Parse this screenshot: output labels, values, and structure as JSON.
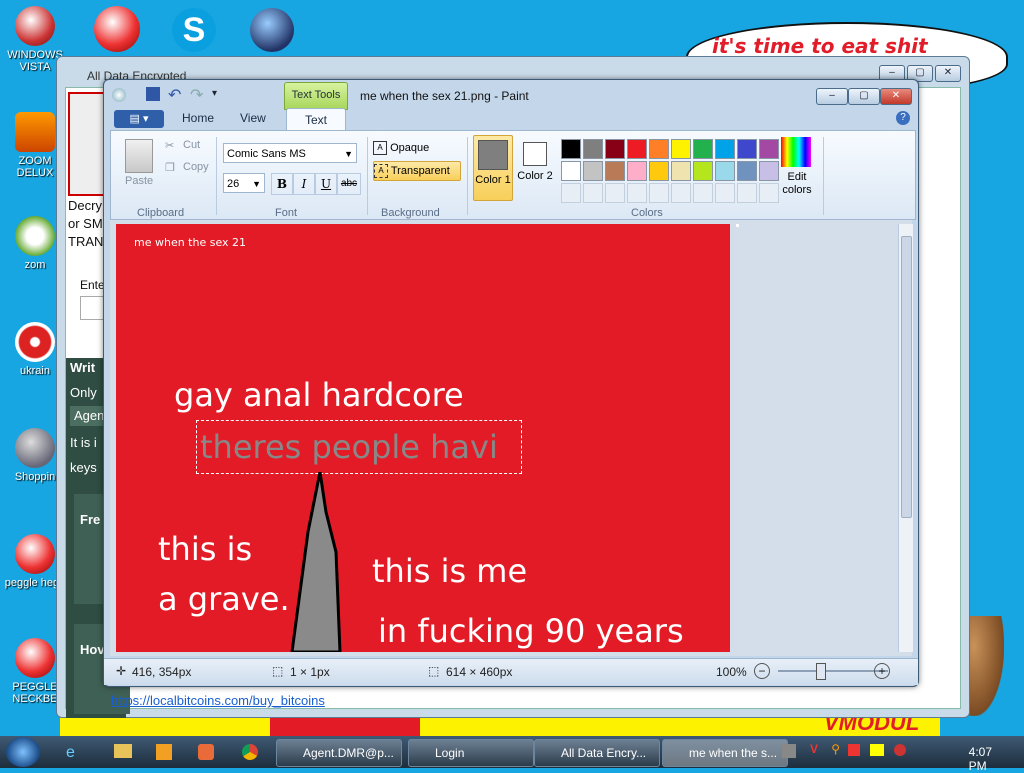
{
  "desktop": {
    "icons": [
      {
        "label": "WINDOWS VISTA"
      },
      {
        "label": "ZOOM DELUX"
      },
      {
        "label": "zom"
      },
      {
        "label": "ukrain"
      },
      {
        "label": "Shoppin"
      },
      {
        "label": "peggle hegg"
      },
      {
        "label": "PEGGLE NECKBE"
      }
    ],
    "cloud_text": "it's time to eat shit",
    "bottom_brand": "VMODUL"
  },
  "background_window": {
    "title": "All Data Encrypted",
    "lines": [
      "Decry",
      "or SM",
      "TRAN",
      "Ente"
    ],
    "green_lines": [
      "Writ",
      "Only",
      "Agen",
      "It is i",
      "keys"
    ],
    "sections": [
      "Fre",
      "Hov"
    ],
    "link": "https://localbitcoins.com/buy_bitcoins"
  },
  "paint": {
    "context_tab": "Text Tools",
    "title": "me when the sex 21.png - Paint",
    "tabs": {
      "home": "Home",
      "view": "View",
      "text": "Text"
    },
    "clipboard": {
      "paste": "Paste",
      "cut": "Cut",
      "copy": "Copy",
      "label": "Clipboard"
    },
    "font": {
      "family": "Comic Sans MS",
      "size": "26",
      "bold": "B",
      "italic": "I",
      "underline": "U",
      "strike": "abc",
      "label": "Font"
    },
    "background": {
      "opaque": "Opaque",
      "transparent": "Transparent",
      "label": "Background"
    },
    "colors": {
      "color1": "Color 1",
      "color2": "Color 2",
      "label": "Colors",
      "edit": "Edit colors",
      "palette_row1": [
        "#000000",
        "#7f7f7f",
        "#880015",
        "#ed1c24",
        "#ff7f27",
        "#fff200",
        "#22b14c",
        "#00a2e8",
        "#3f48cc",
        "#a349a4"
      ],
      "palette_row2": [
        "#ffffff",
        "#c3c3c3",
        "#b97a57",
        "#ffaec9",
        "#ffc90e",
        "#efe4b0",
        "#b5e61d",
        "#99d9ea",
        "#7092be",
        "#c8bfe7"
      ]
    },
    "canvas": {
      "caption": "me when the sex 21",
      "line1": "gay anal hardcore",
      "typing": "theres people havi",
      "grave1": "this is",
      "grave2": "a grave.",
      "me1": "this is me",
      "me2": "in fucking 90 years",
      "bg_color": "#e31b26"
    },
    "status": {
      "cursor": "416, 354px",
      "selection": "1 × 1px",
      "size": "614 × 460px",
      "zoom": "100%"
    }
  },
  "taskbar": {
    "buttons": [
      "Agent.DMR@p...",
      "Login",
      "All Data Encry...",
      "me when the s..."
    ],
    "clock": "4:07 PM"
  }
}
